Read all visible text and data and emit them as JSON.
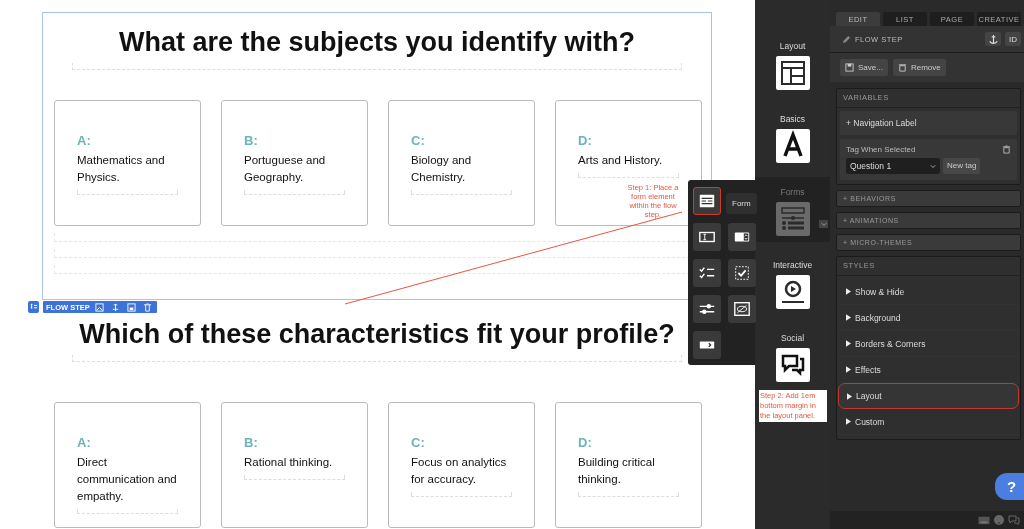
{
  "sections": [
    {
      "title": "What are the subjects you identify with?",
      "selected": true,
      "options": [
        {
          "letter": "A:",
          "text": "Mathematics and Physics."
        },
        {
          "letter": "B:",
          "text": "Portuguese and Geography."
        },
        {
          "letter": "C:",
          "text": "Biology and Chemistry."
        },
        {
          "letter": "D:",
          "text": "Arts and History."
        }
      ]
    },
    {
      "title": "Which of these characteristics fit your profile?",
      "selected": false,
      "options": [
        {
          "letter": "A:",
          "text": "Direct communication and empathy."
        },
        {
          "letter": "B:",
          "text": "Rational thinking."
        },
        {
          "letter": "C:",
          "text": "Focus on analytics for accuracy."
        },
        {
          "letter": "D:",
          "text": "Building critical thinking."
        }
      ]
    }
  ],
  "flow_step_toolbar": {
    "label": "FLOW STEP"
  },
  "categories": [
    {
      "label": "Layout",
      "kind": "layout",
      "selected": false
    },
    {
      "label": "Basics",
      "kind": "basics",
      "selected": false
    },
    {
      "label": "Forms",
      "kind": "forms",
      "selected": true
    },
    {
      "label": "Interactive",
      "kind": "interactive",
      "selected": false
    },
    {
      "label": "Social",
      "kind": "social",
      "selected": false
    }
  ],
  "palette": {
    "tooltip": "Form",
    "items": [
      {
        "kind": "form",
        "highlighted": true
      },
      {
        "kind": "input",
        "highlighted": false
      },
      {
        "kind": "select",
        "highlighted": false
      },
      {
        "kind": "checklist",
        "highlighted": false
      },
      {
        "kind": "checkbox",
        "highlighted": false
      },
      {
        "kind": "slider",
        "highlighted": false
      },
      {
        "kind": "hidden",
        "highlighted": false
      },
      {
        "kind": "submit",
        "highlighted": false
      }
    ]
  },
  "annotations": [
    {
      "text": "Step 1: Place a form element within the flow step."
    },
    {
      "text": "Step 2: Add 1em bottom margin in the layout panel."
    }
  ],
  "panel": {
    "tabs": [
      {
        "label": "EDIT",
        "selected": true
      },
      {
        "label": "LIST",
        "selected": false
      },
      {
        "label": "PAGE",
        "selected": false
      },
      {
        "label": "CREATIVE",
        "selected": false
      }
    ],
    "header": "FLOW STEP",
    "id_button": "ID",
    "buttons": [
      "Save...",
      "Remove"
    ],
    "variables": {
      "title": "VARIABLES",
      "navigation_label": "+ Navigation Label",
      "tag_label": "Tag When Selected",
      "tag_value": "Question 1",
      "new_tag": "New tag"
    },
    "collapsed": [
      "+ BEHAVIORS",
      "+ ANIMATIONS",
      "+ MICRO-THEMES"
    ],
    "styles": {
      "title": "STYLES",
      "items": [
        {
          "label": "Show & Hide",
          "highlighted": false
        },
        {
          "label": "Background",
          "highlighted": false
        },
        {
          "label": "Borders & Corners",
          "highlighted": false
        },
        {
          "label": "Effects",
          "highlighted": false
        },
        {
          "label": "Layout",
          "highlighted": true
        },
        {
          "label": "Custom",
          "highlighted": false
        }
      ]
    }
  },
  "help_button": "?"
}
